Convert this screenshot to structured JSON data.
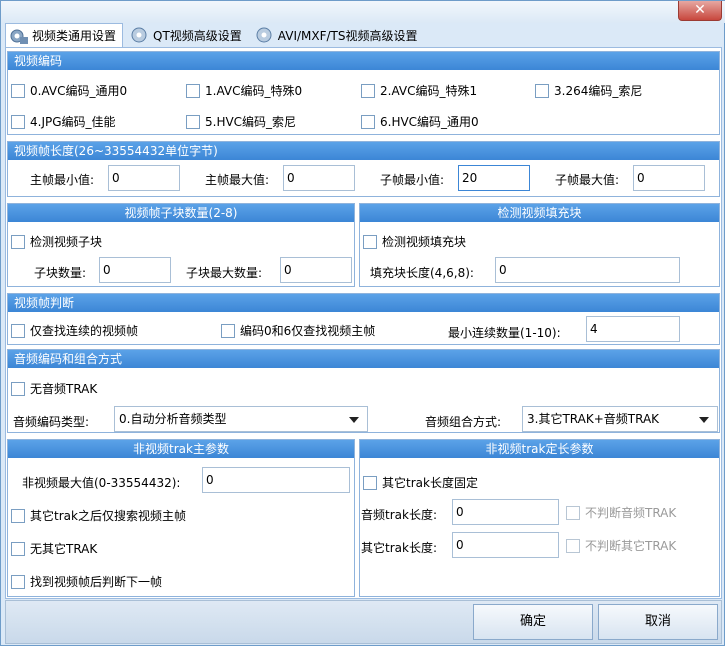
{
  "window": {
    "close_glyph": "✕"
  },
  "tabs": [
    {
      "label": "视频类通用设置",
      "icon": "gear-icon"
    },
    {
      "label": "QT视频高级设置",
      "icon": "gear-icon"
    },
    {
      "label": "AVI/MXF/TS视频高级设置",
      "icon": "gear-icon"
    }
  ],
  "video_encoding": {
    "title": "视频编码",
    "options": [
      "0.AVC编码_通用0",
      "1.AVC编码_特殊0",
      "2.AVC编码_特殊1",
      "3.264编码_索尼",
      "4.JPG编码_佳能",
      "5.HVC编码_索尼",
      "6.HVC编码_通用0"
    ]
  },
  "frame_length": {
    "title": "视频帧长度(26~33554432单位字节)",
    "main_min_label": "主帧最小值:",
    "main_min_value": "0",
    "main_max_label": "主帧最大值:",
    "main_max_value": "0",
    "sub_min_label": "子帧最小值:",
    "sub_min_value": "20",
    "sub_max_label": "子帧最大值:",
    "sub_max_value": "0"
  },
  "sub_blocks": {
    "title": "视频帧子块数量(2-8)",
    "detect_label": "检测视频子块",
    "count_label": "子块数量:",
    "count_value": "0",
    "max_label": "子块最大数量:",
    "max_value": "0"
  },
  "fill_blocks": {
    "title": "检测视频填充块",
    "detect_label": "检测视频填充块",
    "length_label": "填充块长度(4,6,8):",
    "length_value": "0"
  },
  "frame_judge": {
    "title": "视频帧判断",
    "consecutive_label": "仅查找连续的视频帧",
    "codec_label": "编码0和6仅查找视频主帧",
    "min_count_label": "最小连续数量(1-10):",
    "min_count_value": "4"
  },
  "audio": {
    "title": "音频编码和组合方式",
    "no_audio_label": "无音频TRAK",
    "codec_type_label": "音频编码类型:",
    "codec_type_value": "0.自动分析音频类型",
    "combine_label": "音频组合方式:",
    "combine_value": "3.其它TRAK+音频TRAK"
  },
  "non_video": {
    "title": "非视频trak主参数",
    "max_label": "非视频最大值(0-33554432):",
    "max_value": "0",
    "search_main_label": "其它trak之后仅搜索视频主帧",
    "no_other_label": "无其它TRAK",
    "judge_next_label": "找到视频帧后判断下一帧"
  },
  "fixed_len": {
    "title": "非视频trak定长参数",
    "fixed_label": "其它trak长度固定",
    "audio_len_label": "音频trak长度:",
    "audio_len_value": "0",
    "audio_nojudge_label": "不判断音频TRAK",
    "other_len_label": "其它trak长度:",
    "other_len_value": "0",
    "other_nojudge_label": "不判断其它TRAK"
  },
  "footer": {
    "ok_label": "确定",
    "cancel_label": "取消"
  }
}
